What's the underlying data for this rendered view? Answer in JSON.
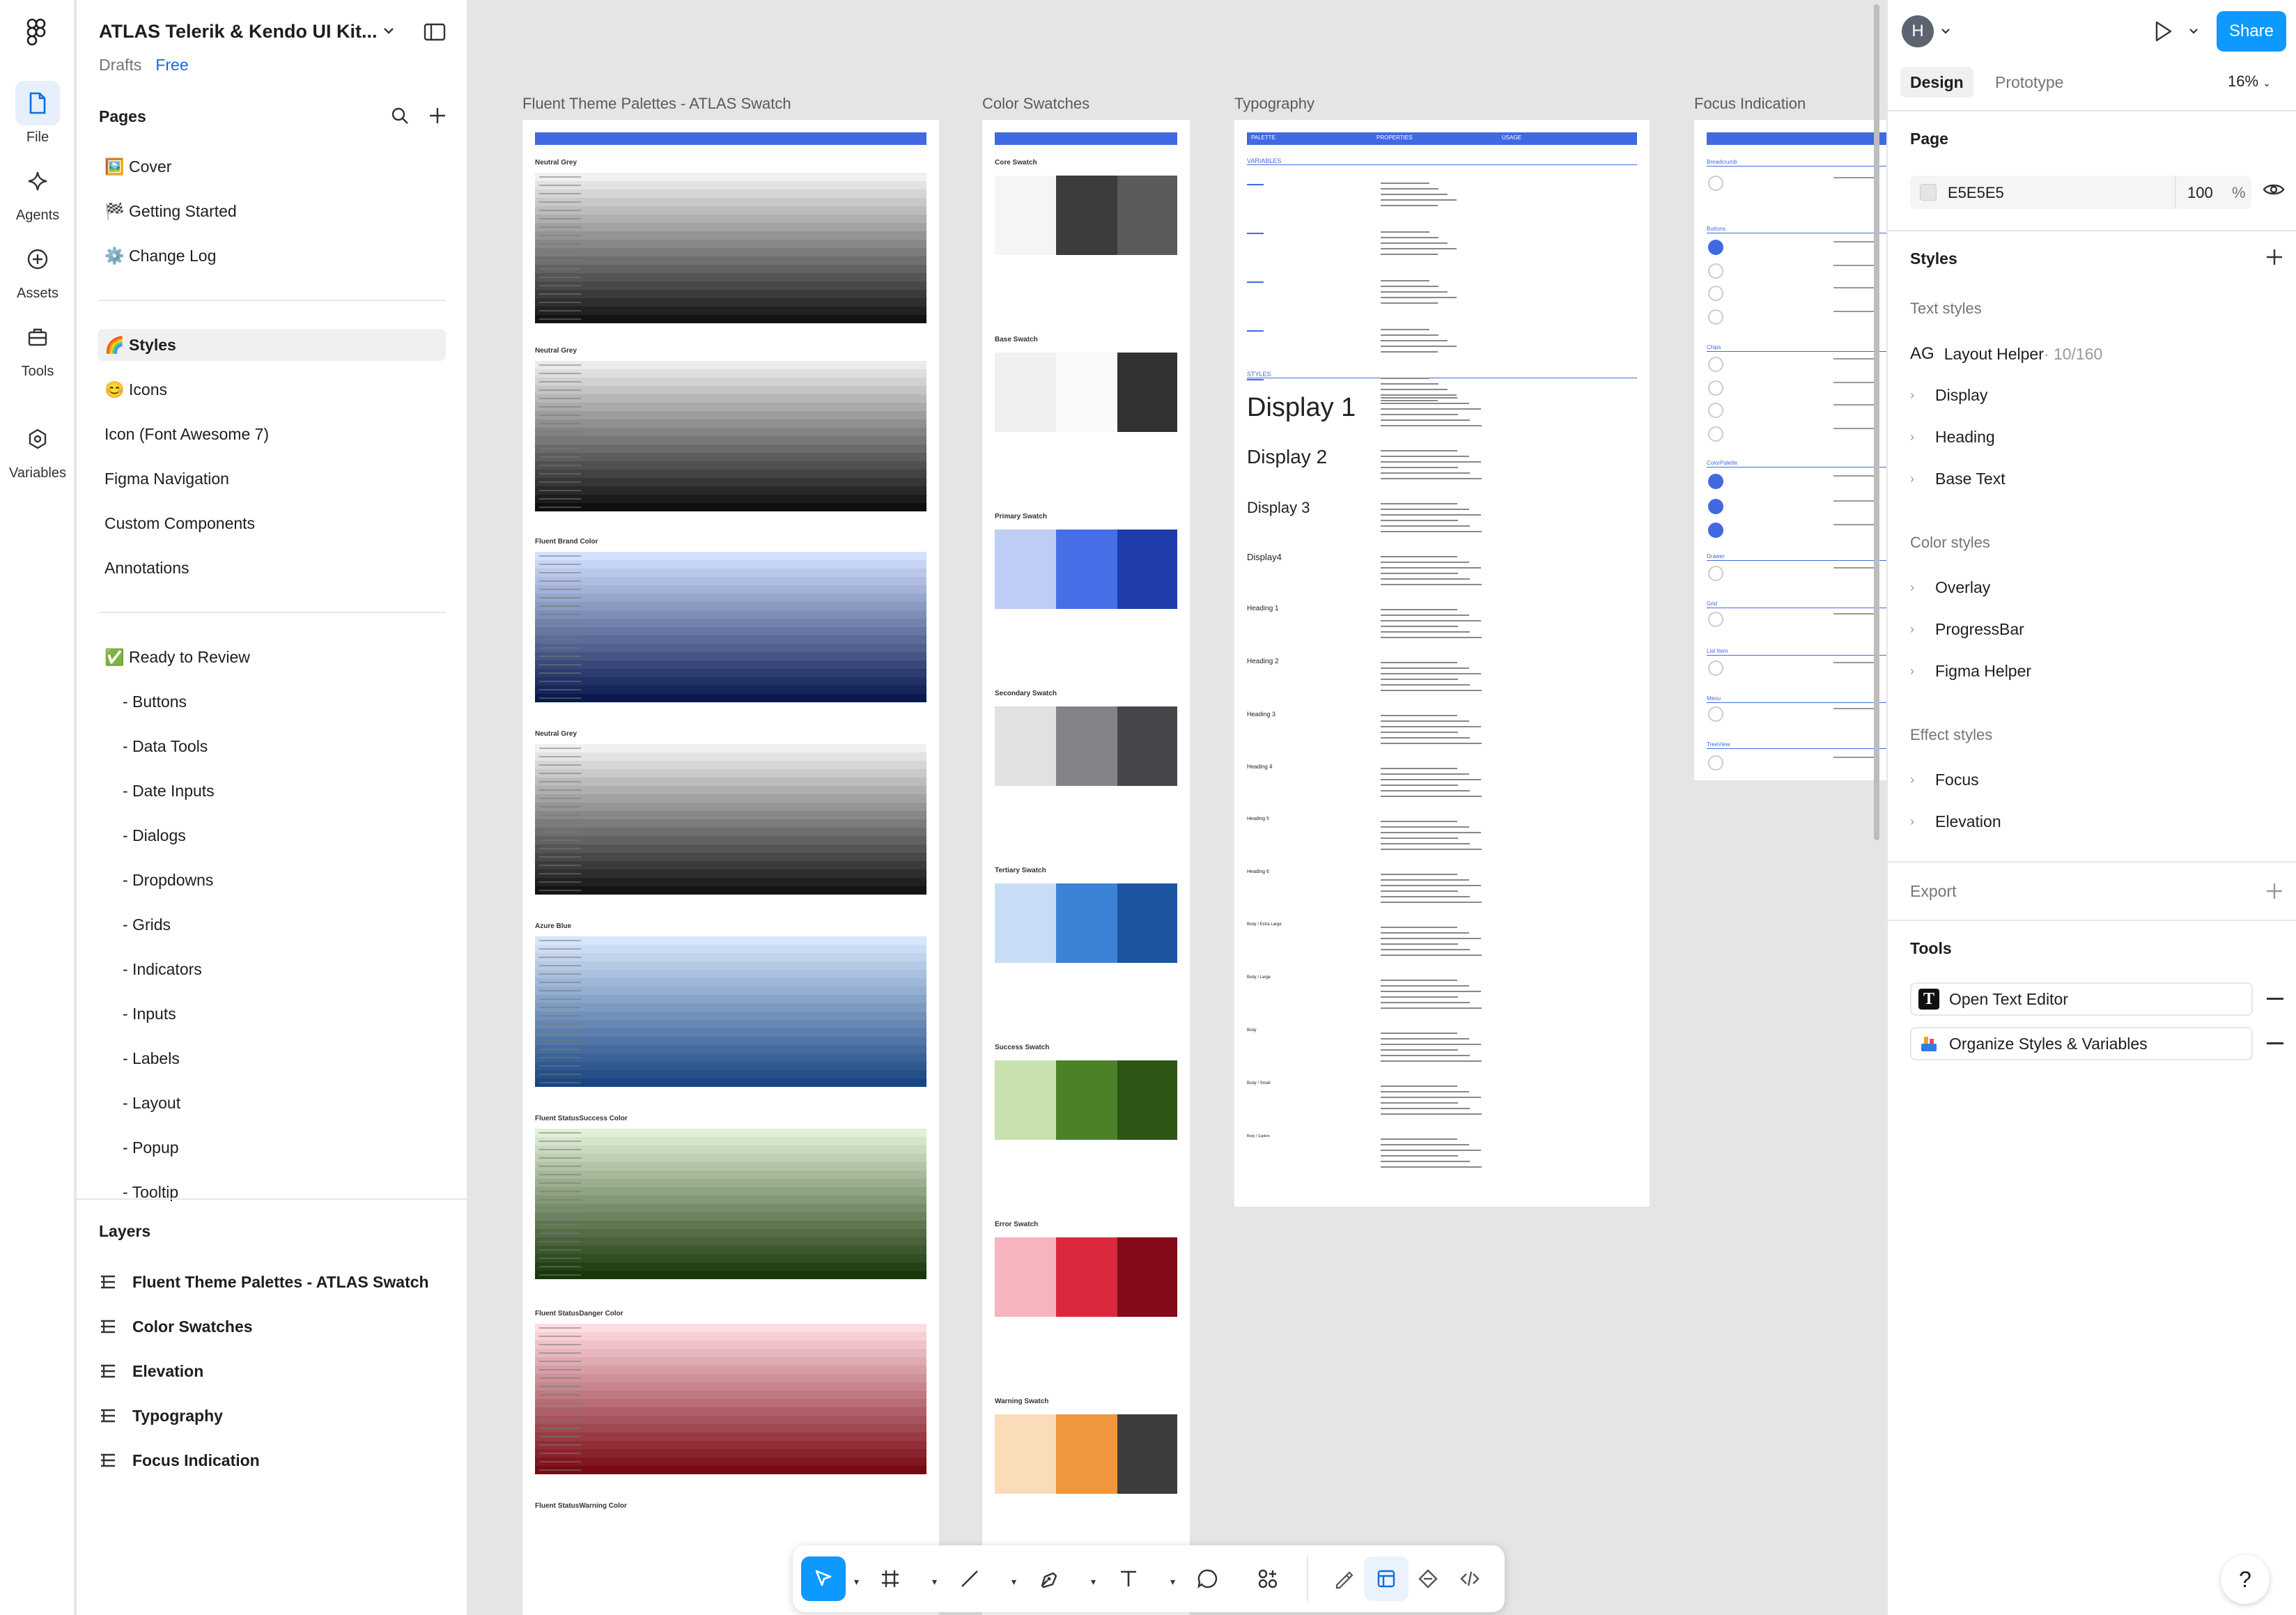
{
  "rail": {
    "file": "File",
    "agents": "Agents",
    "assets": "Assets",
    "tools": "Tools",
    "variables": "Variables"
  },
  "file": {
    "title": "ATLAS Telerik & Kendo UI Kit...",
    "location": "Drafts",
    "plan": "Free"
  },
  "pages": {
    "header": "Pages",
    "items": [
      {
        "label": "🖼️ Cover"
      },
      {
        "label": "🏁 Getting Started"
      },
      {
        "label": "⚙️ Change Log"
      },
      {
        "label": "🌈 Styles",
        "selected": true
      },
      {
        "label": "😊 Icons"
      },
      {
        "label": "Icon (Font Awesome 7)"
      },
      {
        "label": "Figma Navigation"
      },
      {
        "label": "Custom Components"
      },
      {
        "label": "Annotations"
      },
      {
        "label": "✅ Ready to Review"
      },
      {
        "label": "- Buttons"
      },
      {
        "label": "- Data Tools"
      },
      {
        "label": "- Date Inputs"
      },
      {
        "label": "- Dialogs"
      },
      {
        "label": "- Dropdowns"
      },
      {
        "label": "- Grids"
      },
      {
        "label": "- Indicators"
      },
      {
        "label": "- Inputs"
      },
      {
        "label": "- Labels"
      },
      {
        "label": "- Layout"
      },
      {
        "label": "- Popup"
      },
      {
        "label": "- Tooltip"
      }
    ]
  },
  "layers": {
    "header": "Layers",
    "items": [
      "Fluent Theme Palettes - ATLAS Swatch",
      "Color Swatches",
      "Elevation",
      "Typography",
      "Focus Indication"
    ]
  },
  "canvas": {
    "frames": [
      "Fluent Theme Palettes - ATLAS Swatch",
      "Color Swatches",
      "Typography",
      "Focus Indication"
    ],
    "palette_sections": [
      "Neutral Grey",
      "Neutral Grey",
      "Fluent Brand Color",
      "Neutral Grey",
      "Azure Blue",
      "Fluent StatusSuccess Color",
      "Fluent StatusDanger Color",
      "Fluent StatusWarning Color"
    ],
    "swatch_sections": [
      "Core Swatch",
      "Base Swatch",
      "Primary Swatch",
      "Secondary Swatch",
      "Tertiary Swatch",
      "Success Swatch",
      "Error Swatch",
      "Warning Swatch"
    ],
    "type_header": [
      "PALETTE",
      "PROPERTIES",
      "USAGE"
    ],
    "type_sub": [
      "VARIABLES",
      "STYLES"
    ],
    "type_samples": [
      "Display 1",
      "Display 2",
      "Display 3",
      "Display4",
      "Heading 1",
      "Heading 2",
      "Heading 3",
      "Heading 4",
      "Heading 5",
      "Heading 6",
      "Body / Extra Large",
      "Body / Large",
      "Body",
      "Body / Small",
      "Body / Caption"
    ],
    "focus_sections": [
      "Breadcrumb",
      "Buttons",
      "Chips",
      "ColorPalette",
      "Drawer",
      "Grid",
      "List Item",
      "Menu",
      "TreeView"
    ]
  },
  "right": {
    "avatar": "H",
    "share": "Share",
    "tabs": [
      "Design",
      "Prototype"
    ],
    "zoom": "16%",
    "page": {
      "header": "Page",
      "color": "E5E5E5",
      "opacity": "100",
      "unit": "%"
    },
    "styles": {
      "header": "Styles",
      "text_styles": "Text styles",
      "helper": "Layout Helper",
      "helper_ag": "AG",
      "helper_count": " · 10/160",
      "text_groups": [
        "Display",
        "Heading",
        "Base Text"
      ],
      "color_styles": "Color styles",
      "color_groups": [
        "Overlay",
        "ProgressBar",
        "Figma Helper"
      ],
      "effect_styles": "Effect styles",
      "effect_groups": [
        "Focus",
        "Elevation"
      ]
    },
    "export": "Export",
    "tools": {
      "header": "Tools",
      "items": [
        "Open Text Editor",
        "Organize Styles & Variables"
      ]
    }
  },
  "help": "?",
  "colors": {
    "accent": "#0d99ff",
    "brand_blue": "#4169e1",
    "success": "#3a6b1c",
    "danger": "#c8102e",
    "warning": "#e8892c"
  }
}
